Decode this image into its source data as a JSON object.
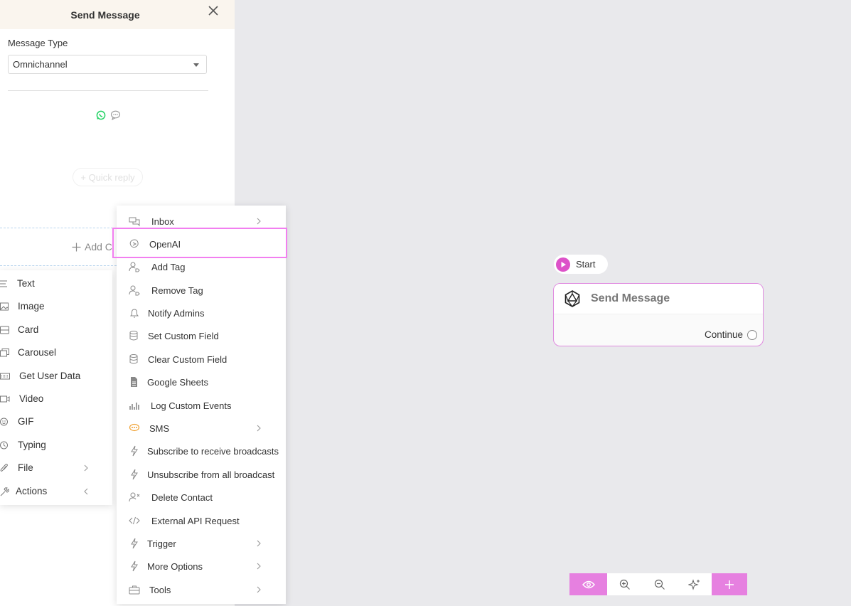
{
  "panel": {
    "title": "Send Message",
    "message_type_label": "Message Type",
    "message_type_value": "Omnichannel",
    "quick_reply_label": "+ Quick reply",
    "add_content_label": "Add C"
  },
  "content_menu": {
    "items": [
      {
        "label": "Text",
        "icon": "text-lines-icon"
      },
      {
        "label": "Image",
        "icon": "image-icon"
      },
      {
        "label": "Card",
        "icon": "card-icon"
      },
      {
        "label": "Carousel",
        "icon": "carousel-icon"
      },
      {
        "label": "Get User Data",
        "icon": "keyboard-icon"
      },
      {
        "label": "Video",
        "icon": "video-icon"
      },
      {
        "label": "GIF",
        "icon": "smiley-icon"
      },
      {
        "label": "Typing",
        "icon": "clock-icon"
      },
      {
        "label": "File",
        "icon": "paperclip-icon"
      },
      {
        "label": "Actions",
        "icon": "wrench-icon"
      }
    ]
  },
  "actions_menu": {
    "items": [
      {
        "label": "Inbox",
        "icon": "chat-bubbles-icon"
      },
      {
        "label": "OpenAI",
        "icon": "openai-icon"
      },
      {
        "label": "Add Tag",
        "icon": "user-tag-icon"
      },
      {
        "label": "Remove Tag",
        "icon": "user-tag-icon"
      },
      {
        "label": "Notify Admins",
        "icon": "bell-icon"
      },
      {
        "label": "Set Custom Field",
        "icon": "database-icon"
      },
      {
        "label": "Clear Custom Field",
        "icon": "database-icon"
      },
      {
        "label": "Google Sheets",
        "icon": "sheet-icon"
      },
      {
        "label": "Log Custom Events",
        "icon": "bar-chart-icon"
      },
      {
        "label": "SMS",
        "icon": "sms-icon"
      },
      {
        "label": "Subscribe to receive broadcasts",
        "icon": "lightning-icon"
      },
      {
        "label": "Unsubscribe from all broadcast",
        "icon": "lightning-icon"
      },
      {
        "label": "Delete Contact",
        "icon": "user-x-icon"
      },
      {
        "label": "External API Request",
        "icon": "code-icon"
      },
      {
        "label": "Trigger",
        "icon": "lightning-icon"
      },
      {
        "label": "More Options",
        "icon": "lightning-icon"
      },
      {
        "label": "Tools",
        "icon": "toolbox-icon"
      }
    ]
  },
  "canvas": {
    "start_label": "Start",
    "node_title": "Send Message",
    "node_continue_label": "Continue"
  },
  "toolbar": {
    "buttons": [
      "eye-icon",
      "zoom-in-icon",
      "zoom-out-icon",
      "sparkle-icon",
      "plus-icon"
    ]
  },
  "colors": {
    "accent": "#e680e0",
    "start": "#dd52c9",
    "highlight": "#f27ff0",
    "whatsapp": "#25d366",
    "sms": "#f0a030"
  }
}
